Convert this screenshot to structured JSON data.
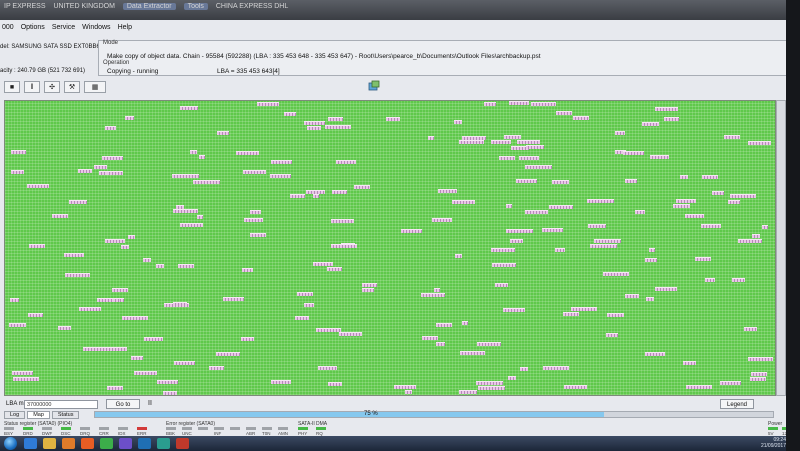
{
  "window": {
    "title_items": [
      "IP EXPRESS",
      "UNITED KINGDOM",
      "Data Extractor",
      "Tools",
      "CHINA EXPRESS DHL"
    ]
  },
  "menu": {
    "items": [
      "000",
      "Options",
      "Service",
      "Windows",
      "Help"
    ]
  },
  "device": {
    "model": "del: SAMSUNG SATA SSD EXT0BB6Q-5-M",
    "capacity": "acity : 240.79 GB (521 732 691)"
  },
  "mode": {
    "label": "Mode",
    "text": "Make copy of object data.  Chain - 95584 (592288) (LBA : 335 453 648 - 335 453 647) - Root\\Users\\pearce_b\\Documents\\Outlook Files\\archbackup.pst",
    "operation_label": "Operation",
    "operation_status": "Copying - running",
    "operation_lba": "LBA =     335 453 643[4]"
  },
  "toolbar": {
    "icons": [
      "stop-icon",
      "pause-icon",
      "tools-icon",
      "settings-icon",
      "map-grid-icon"
    ]
  },
  "map": {
    "good_color": "#5fc84b",
    "copied_color": "#d8b3da"
  },
  "bottom": {
    "lba_label": "LBA map",
    "lba_value": "37000000",
    "goto_label": "Go to",
    "pause_symbol": "II",
    "legend_label": "Legend",
    "progress_text": "75 %",
    "progress_value": 0.75
  },
  "tabs": [
    "Log",
    "Map",
    "Status"
  ],
  "status": {
    "group1_label": "Status register (SATA0) (PIO4)",
    "group1_leds": [
      {
        "label": "BSY",
        "color": "#9fa3a8"
      },
      {
        "label": "DRD",
        "color": "#46b946"
      },
      {
        "label": "DWF",
        "color": "#9fa3a8"
      },
      {
        "label": "DSC",
        "color": "#46b946"
      },
      {
        "label": "DRQ",
        "color": "#9fa3a8"
      },
      {
        "label": "CRR",
        "color": "#9fa3a8"
      },
      {
        "label": "IDX",
        "color": "#9fa3a8"
      },
      {
        "label": "ERR",
        "color": "#d23a3a"
      }
    ],
    "group2_label": "Error register (SATA0)",
    "group2_leds": [
      {
        "label": "BBK",
        "color": "#9fa3a8"
      },
      {
        "label": "UNC",
        "color": "#9fa3a8"
      },
      {
        "label": "",
        "color": "#9fa3a8"
      },
      {
        "label": "INF",
        "color": "#9fa3a8"
      },
      {
        "label": "",
        "color": "#9fa3a8"
      },
      {
        "label": "ABR",
        "color": "#9fa3a8"
      },
      {
        "label": "T0N",
        "color": "#9fa3a8"
      },
      {
        "label": "AMN",
        "color": "#9fa3a8"
      }
    ],
    "group3_label": "SATA-II",
    "group3_leds": [
      {
        "label": "PHY",
        "color": "#46b946"
      }
    ],
    "group4_label": "DMA",
    "group4_leds": [
      {
        "label": "RQ",
        "color": "#46b946"
      }
    ],
    "power_label": "Power",
    "power_leds": [
      {
        "label": "5V",
        "color": "#46b946"
      },
      {
        "label": "12V",
        "color": "#46b946"
      }
    ]
  },
  "taskbar": {
    "icons": [
      "ie-icon",
      "folder-icon",
      "media-icon",
      "firefox-icon",
      "chrome-icon",
      "app-icon",
      "app2-icon",
      "app3-icon",
      "app4-icon"
    ],
    "icon_colors": [
      "#2f7bd7",
      "#e0b341",
      "#e07b2a",
      "#e85d24",
      "#3cae4a",
      "#6c4fc8",
      "#1f6fb3",
      "#2a9d8f",
      "#c0392b"
    ],
    "time": "09:24",
    "date": "21/09/2017"
  }
}
